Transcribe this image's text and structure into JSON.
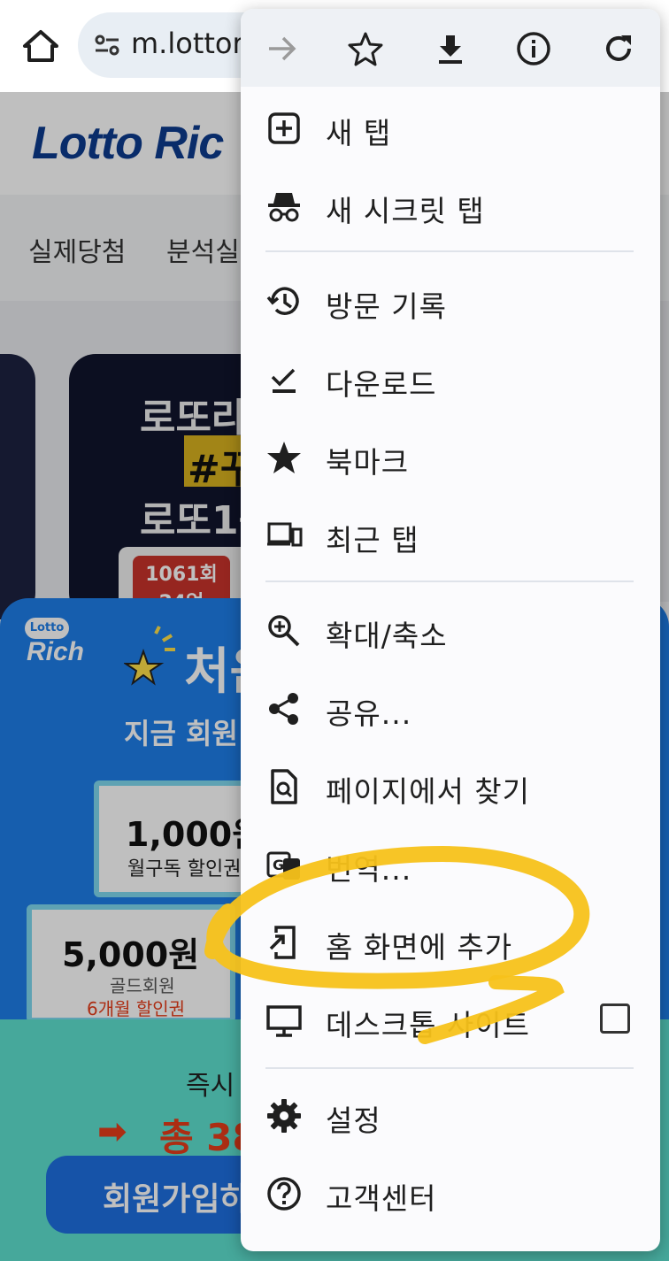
{
  "browser": {
    "url": "m.lottor",
    "icons": [
      "home-icon",
      "site-settings-icon",
      "forward-icon",
      "bookmark-star-icon",
      "download-icon",
      "info-icon",
      "refresh-icon"
    ]
  },
  "page": {
    "logo": "Lotto Ric",
    "nav": [
      "실제당첨",
      "분석실"
    ],
    "hero": {
      "line1": "로또라",
      "tag": "#꾸",
      "line2": "로또1등",
      "badge_line1": "1061회",
      "badge_line2": "24억"
    },
    "promo": {
      "logo_top": "Lotto",
      "logo": "Rich",
      "title": "처음",
      "subtitle": "지금 회원",
      "coupon1_amount": "1,000원",
      "coupon1_desc": "월구독 할인권",
      "coupon2_amount": "5,000원",
      "coupon2_desc1": "골드회원",
      "coupon2_desc2": "6개월 할인권",
      "join_small": "즉시 ",
      "join_arrow": "➡",
      "join_total": "총 38",
      "join_button": "회원가입하"
    }
  },
  "menu": {
    "items": [
      {
        "label": "새 탭",
        "icon": "new-tab-icon"
      },
      {
        "label": "새 시크릿 탭",
        "icon": "incognito-icon"
      },
      {
        "label": "방문 기록",
        "icon": "history-icon"
      },
      {
        "label": "다운로드",
        "icon": "downloads-icon"
      },
      {
        "label": "북마크",
        "icon": "bookmarks-star-icon"
      },
      {
        "label": "최근 탭",
        "icon": "recent-tabs-devices-icon"
      },
      {
        "label": "확대/축소",
        "icon": "zoom-icon"
      },
      {
        "label": "공유...",
        "icon": "share-icon"
      },
      {
        "label": "페이지에서 찾기",
        "icon": "find-in-page-icon"
      },
      {
        "label": "번역...",
        "icon": "translate-icon"
      },
      {
        "label": "홈 화면에 추가",
        "icon": "add-to-home-screen-icon"
      },
      {
        "label": "데스크톱 사이트",
        "icon": "desktop-site-icon",
        "checked": false
      },
      {
        "label": "설정",
        "icon": "settings-gear-icon"
      },
      {
        "label": "고객센터",
        "icon": "help-icon"
      }
    ]
  },
  "colors": {
    "menu_bg": "#fbfbfd",
    "toolbar_bg": "#eef1f5",
    "url_bg": "#e8eef4",
    "highlight": "#f7c21a",
    "promo_blue": "#1e7ee8",
    "join_teal": "#5ee0cf"
  }
}
